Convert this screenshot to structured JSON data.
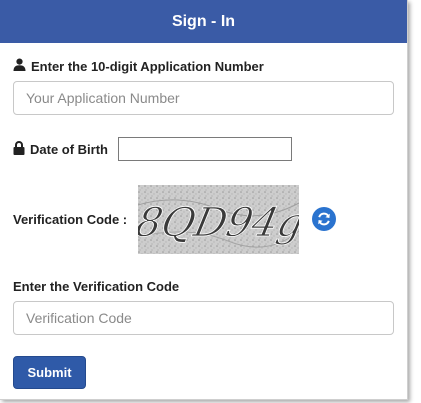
{
  "header": {
    "title": "Sign - In"
  },
  "application_number": {
    "label": "Enter the 10-digit Application Number",
    "placeholder": "Your Application Number",
    "icon": "user-icon"
  },
  "date_of_birth": {
    "label": "Date of Birth",
    "value": "",
    "icon": "lock-icon"
  },
  "verification": {
    "label": "Verification Code :",
    "captcha_text": "8QD94g",
    "refresh_icon": "refresh-icon"
  },
  "verification_input": {
    "label": "Enter the Verification Code",
    "placeholder": "Verification Code"
  },
  "submit": {
    "label": "Submit"
  },
  "colors": {
    "header_bg": "#3a5ba6",
    "button_bg": "#2f5aa8",
    "refresh_bg": "#2a73cf"
  }
}
